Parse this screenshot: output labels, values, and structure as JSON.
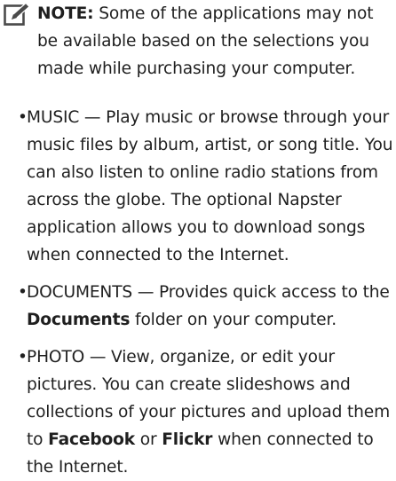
{
  "note": {
    "icon": "pencil-note-icon",
    "label": "NOTE:",
    "text": " Some of the applications may not be available based on the selections you made while purchasing your computer."
  },
  "items": [
    {
      "bullet": "•",
      "segments": [
        "MUSIC — Play music or browse through your music files by album, artist, or song title. You can also listen to online radio stations from across the globe. The optional Napster application allows you to download songs when connected to the Internet."
      ]
    },
    {
      "bullet": "•",
      "segments": [
        "DOCUMENTS — Provides quick access to the ",
        "Documents",
        " folder on your computer."
      ]
    },
    {
      "bullet": "•",
      "segments": [
        "PHOTO — View, organize, or edit your pictures. You can create slideshows and collections of your pictures and upload them to ",
        "Facebook",
        " or ",
        "Flickr",
        " when connected to the Internet."
      ]
    }
  ]
}
